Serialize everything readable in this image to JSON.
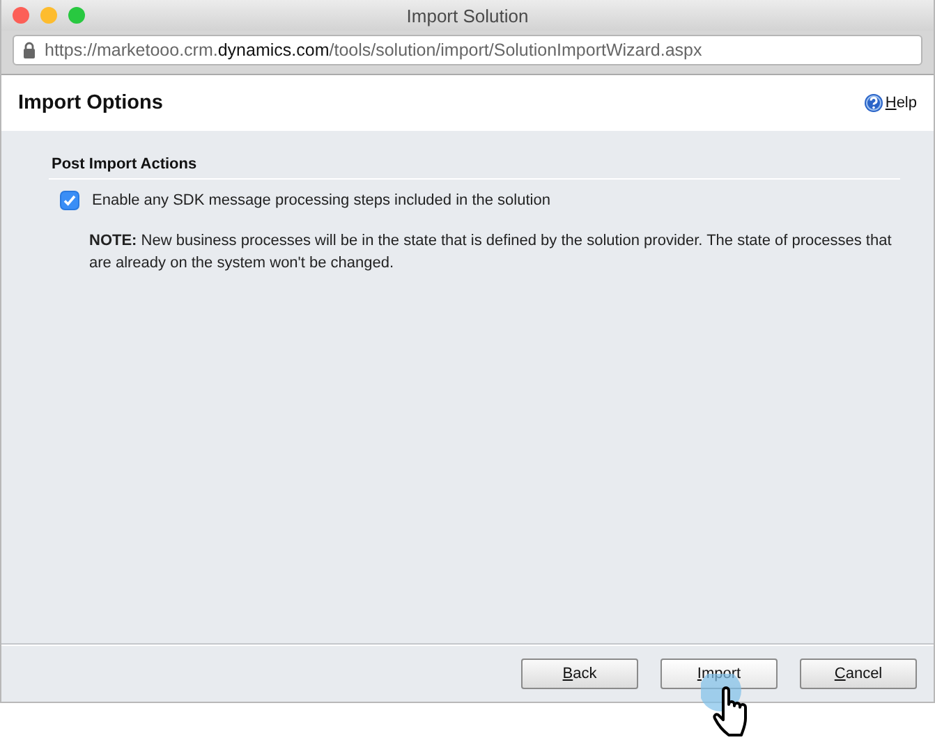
{
  "window": {
    "title": "Import Solution"
  },
  "address_bar": {
    "url_prefix": "https://marketooo.crm.",
    "url_domain": "dynamics.com",
    "url_path": "/tools/solution/import/SolutionImportWizard.aspx"
  },
  "header": {
    "title": "Import Options",
    "help": {
      "key": "H",
      "rest": "elp"
    }
  },
  "section": {
    "title": "Post Import Actions",
    "option": {
      "label": "Enable any SDK message processing steps included in the solution",
      "checked": true
    },
    "note": "**NOTE:** New business processes will be in the state that is defined by the solution provider. The state of processes that are already on the system won't be changed."
  },
  "buttons": [
    {
      "key": "B",
      "rest": "ack",
      "hovered": false
    },
    {
      "key": "I",
      "rest": "mport",
      "hovered": true
    },
    {
      "key": "C",
      "rest": "ancel",
      "hovered": false
    }
  ]
}
